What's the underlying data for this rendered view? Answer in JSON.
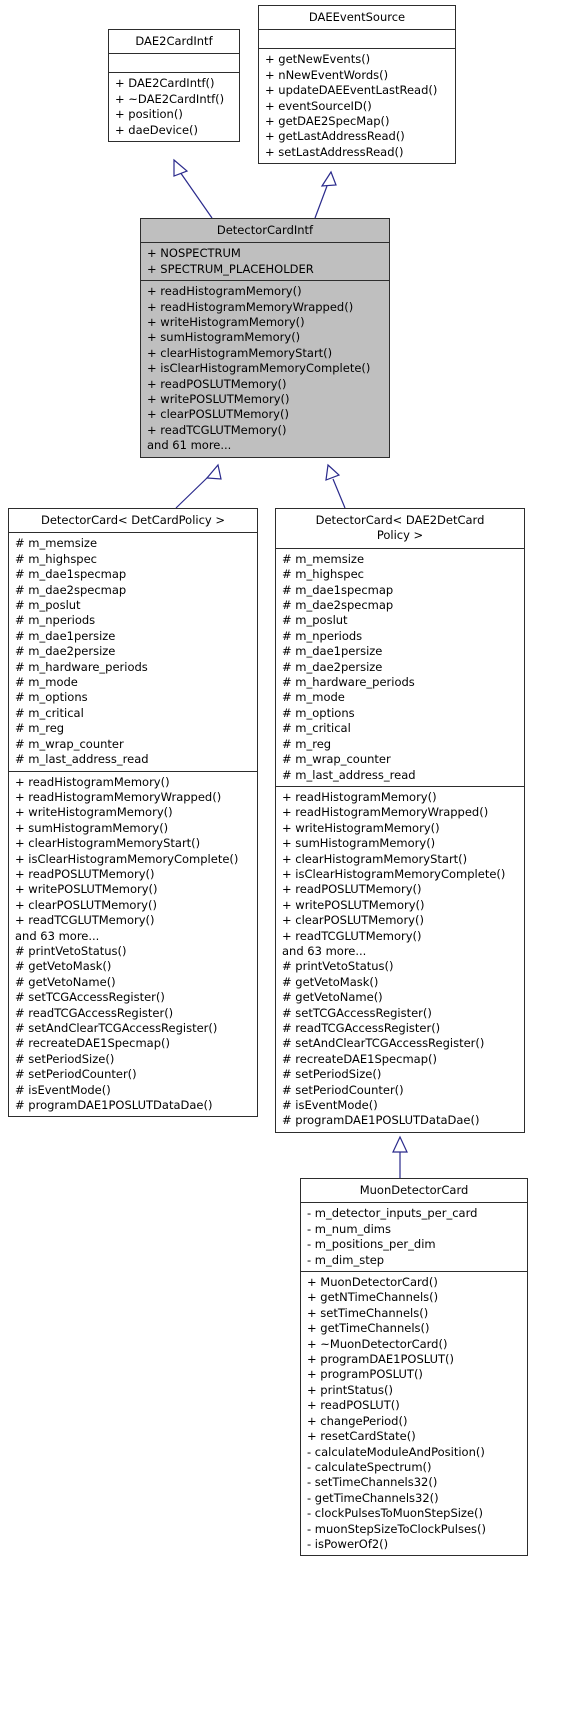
{
  "diagram": {
    "type": "uml-class-inheritance",
    "title": "DetectorCard class hierarchy"
  },
  "classes": {
    "dae2cardintf": {
      "name": "DAE2CardIntf",
      "attributes": [],
      "operations": [
        "+ DAE2CardIntf()",
        "+ ~DAE2CardIntf()",
        "+ position()",
        "+ daeDevice()"
      ]
    },
    "daeeventsource": {
      "name": "DAEEventSource",
      "attributes": [],
      "operations": [
        "+ getNewEvents()",
        "+ nNewEventWords()",
        "+ updateDAEEventLastRead()",
        "+ eventSourceID()",
        "+ getDAE2SpecMap()",
        "+ getLastAddressRead()",
        "+ setLastAddressRead()"
      ]
    },
    "detectorcardintf": {
      "name": "DetectorCardIntf",
      "attributes": [
        "+ NOSPECTRUM",
        "+ SPECTRUM_PLACEHOLDER"
      ],
      "operations": [
        "+ readHistogramMemory()",
        "+ readHistogramMemoryWrapped()",
        "+ writeHistogramMemory()",
        "+ sumHistogramMemory()",
        "+ clearHistogramMemoryStart()",
        "+ isClearHistogramMemoryComplete()",
        "+ readPOSLUTMemory()",
        "+ writePOSLUTMemory()",
        "+ clearPOSLUTMemory()",
        "+ readTCGLUTMemory()",
        "and 61 more..."
      ]
    },
    "detectorcard_det": {
      "name": "DetectorCard< DetCardPolicy >",
      "attributes": [
        "# m_memsize",
        "# m_highspec",
        "# m_dae1specmap",
        "# m_dae2specmap",
        "# m_poslut",
        "# m_nperiods",
        "# m_dae1persize",
        "# m_dae2persize",
        "# m_hardware_periods",
        "# m_mode",
        "# m_options",
        "# m_critical",
        "# m_reg",
        "# m_wrap_counter",
        "# m_last_address_read"
      ],
      "operations": [
        "+ readHistogramMemory()",
        "+ readHistogramMemoryWrapped()",
        "+ writeHistogramMemory()",
        "+ sumHistogramMemory()",
        "+ clearHistogramMemoryStart()",
        "+ isClearHistogramMemoryComplete()",
        "+ readPOSLUTMemory()",
        "+ writePOSLUTMemory()",
        "+ clearPOSLUTMemory()",
        "+ readTCGLUTMemory()",
        "and 63 more...",
        "# printVetoStatus()",
        "# getVetoMask()",
        "# getVetoName()",
        "# setTCGAccessRegister()",
        "# readTCGAccessRegister()",
        "# setAndClearTCGAccessRegister()",
        "# recreateDAE1Specmap()",
        "# setPeriodSize()",
        "# setPeriodCounter()",
        "# isEventMode()",
        "# programDAE1POSLUTDataDae()"
      ]
    },
    "detectorcard_dae2": {
      "name": "DetectorCard< DAE2DetCard\nPolicy >",
      "attributes": [
        "# m_memsize",
        "# m_highspec",
        "# m_dae1specmap",
        "# m_dae2specmap",
        "# m_poslut",
        "# m_nperiods",
        "# m_dae1persize",
        "# m_dae2persize",
        "# m_hardware_periods",
        "# m_mode",
        "# m_options",
        "# m_critical",
        "# m_reg",
        "# m_wrap_counter",
        "# m_last_address_read"
      ],
      "operations": [
        "+ readHistogramMemory()",
        "+ readHistogramMemoryWrapped()",
        "+ writeHistogramMemory()",
        "+ sumHistogramMemory()",
        "+ clearHistogramMemoryStart()",
        "+ isClearHistogramMemoryComplete()",
        "+ readPOSLUTMemory()",
        "+ writePOSLUTMemory()",
        "+ clearPOSLUTMemory()",
        "+ readTCGLUTMemory()",
        "and 63 more...",
        "# printVetoStatus()",
        "# getVetoMask()",
        "# getVetoName()",
        "# setTCGAccessRegister()",
        "# readTCGAccessRegister()",
        "# setAndClearTCGAccessRegister()",
        "# recreateDAE1Specmap()",
        "# setPeriodSize()",
        "# setPeriodCounter()",
        "# isEventMode()",
        "# programDAE1POSLUTDataDae()"
      ]
    },
    "muondetectorcard": {
      "name": "MuonDetectorCard",
      "attributes": [
        "- m_detector_inputs_per_card",
        "- m_num_dims",
        "- m_positions_per_dim",
        "- m_dim_step"
      ],
      "operations": [
        "+ MuonDetectorCard()",
        "+ getNTimeChannels()",
        "+ setTimeChannels()",
        "+ getTimeChannels()",
        "+ ~MuonDetectorCard()",
        "+ programDAE1POSLUT()",
        "+ programPOSLUT()",
        "+ printStatus()",
        "+ readPOSLUT()",
        "+ changePeriod()",
        "+ resetCardState()",
        "- calculateModuleAndPosition()",
        "- calculateSpectrum()",
        "- setTimeChannels32()",
        "- getTimeChannels32()",
        "- clockPulsesToMuonStepSize()",
        "- muonStepSizeToClockPulses()",
        "- isPowerOf2()"
      ]
    }
  },
  "edges": [
    {
      "from": "detectorcardintf",
      "to": "dae2cardintf",
      "kind": "inheritance"
    },
    {
      "from": "detectorcardintf",
      "to": "daeeventsource",
      "kind": "inheritance"
    },
    {
      "from": "detectorcard_det",
      "to": "detectorcardintf",
      "kind": "inheritance"
    },
    {
      "from": "detectorcard_dae2",
      "to": "detectorcardintf",
      "kind": "inheritance"
    },
    {
      "from": "muondetectorcard",
      "to": "detectorcard_dae2",
      "kind": "inheritance"
    }
  ],
  "colors": {
    "border": "#2d2d2d",
    "edge": "#2a2a8c",
    "highlight_fill": "#bfbfbf",
    "background": "#ffffff",
    "text": "#000000"
  }
}
